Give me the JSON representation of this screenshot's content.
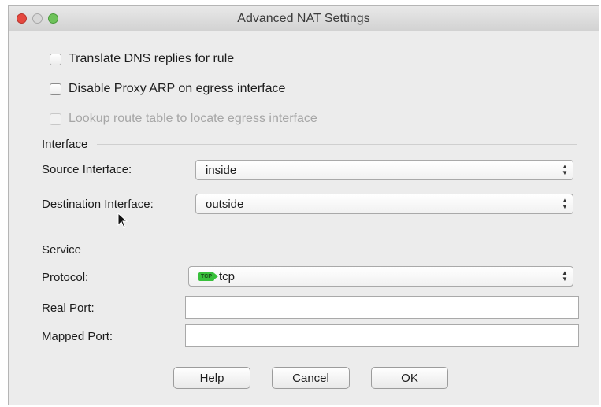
{
  "window": {
    "title": "Advanced NAT Settings"
  },
  "checkboxes": [
    {
      "label": "Translate DNS replies for rule",
      "checked": false,
      "enabled": true
    },
    {
      "label": "Disable Proxy ARP on egress interface",
      "checked": false,
      "enabled": true
    },
    {
      "label": "Lookup route table to locate egress interface",
      "checked": false,
      "enabled": false
    }
  ],
  "interface_section": {
    "heading": "Interface",
    "source_label": "Source Interface:",
    "source_value": "inside",
    "destination_label": "Destination Interface:",
    "destination_value": "outside"
  },
  "service_section": {
    "heading": "Service",
    "protocol_label": "Protocol:",
    "protocol_badge": "TCP",
    "protocol_value": "tcp",
    "real_port_label": "Real Port:",
    "real_port_value": "",
    "mapped_port_label": "Mapped Port:",
    "mapped_port_value": ""
  },
  "buttons": {
    "help": "Help",
    "cancel": "Cancel",
    "ok": "OK"
  },
  "icons": {
    "close": "close-dot-icon",
    "minimize": "minimize-dot-icon",
    "zoom": "zoom-dot-icon",
    "select_arrows": "updown-arrows-icon",
    "protocol": "tcp-protocol-icon",
    "cursor": "mouse-pointer-icon"
  },
  "colors": {
    "close": "#e5483f",
    "zoom": "#6ec25a",
    "tcp_badge": "#38c03b"
  }
}
